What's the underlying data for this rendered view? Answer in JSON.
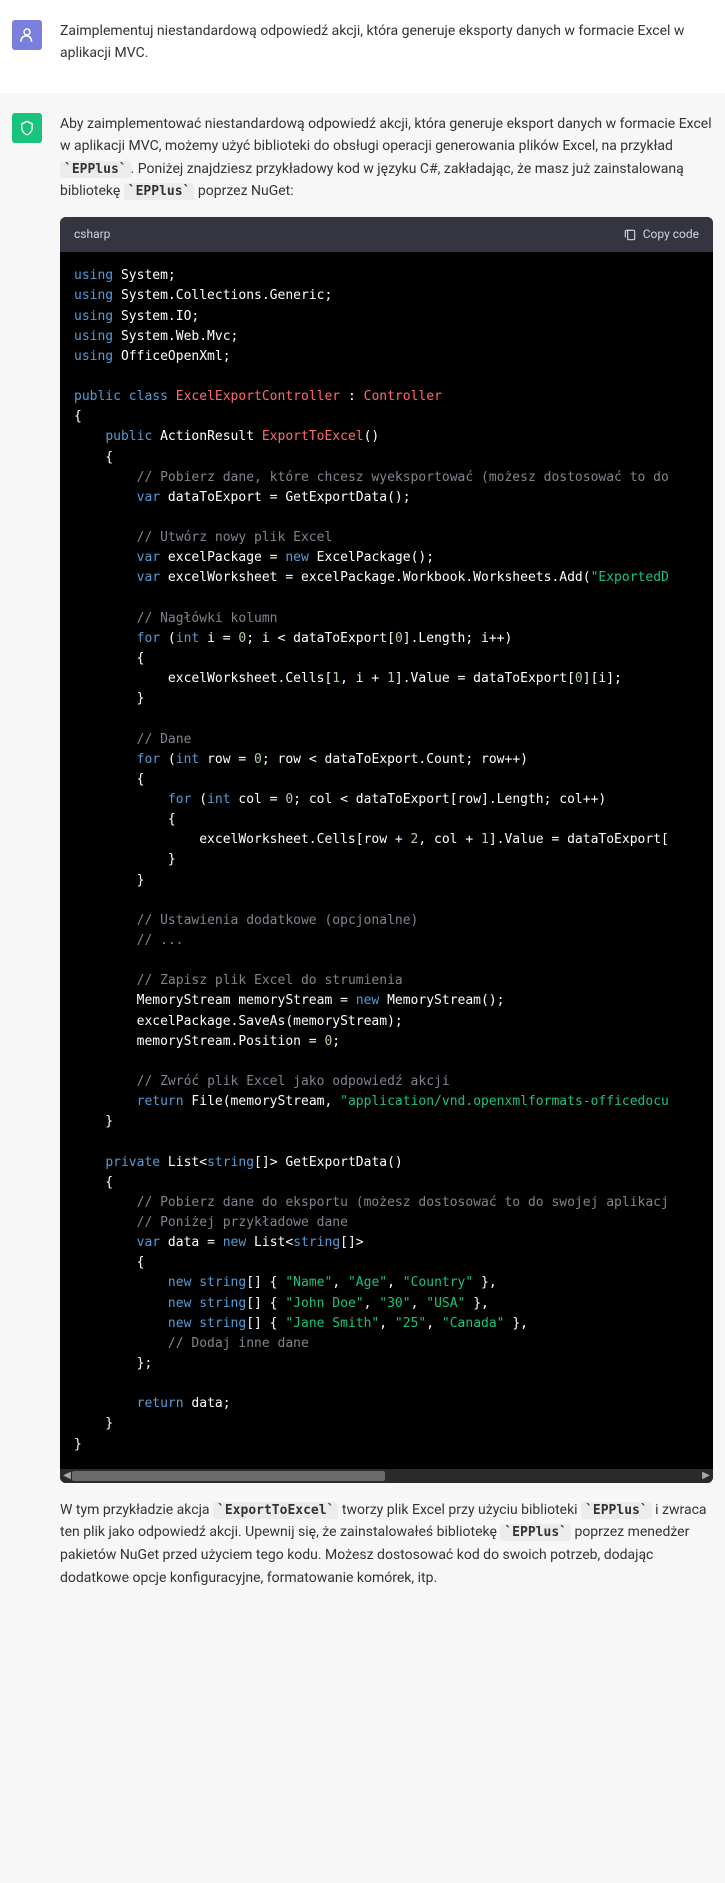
{
  "user": {
    "text": "Zaimplementuj niestandardową odpowiedź akcji, która generuje eksporty danych w formacie Excel w aplikacji MVC."
  },
  "assistant": {
    "intro_parts": [
      "Aby zaimplementować niestandardową odpowiedź akcji, która generuje eksport danych w formacie Excel w aplikacji MVC, możemy użyć biblioteki do obsługi operacji generowania plików Excel, na przykład ",
      ". Poniżej znajdziesz przykładowy kod w języku C#, zakładając, że masz już zainstalowaną bibliotekę ",
      " poprzez NuGet:"
    ],
    "epplus1": "`EPPlus`",
    "epplus2": "`EPPlus`",
    "code_lang": "csharp",
    "copy_label": "Copy code",
    "outro_parts": [
      "W tym przykładzie akcja ",
      " tworzy plik Excel przy użyciu biblioteki ",
      " i zwraca ten plik jako odpowiedź akcji. Upewnij się, że zainstalowałeś bibliotekę ",
      " poprzez menedżer pakietów NuGet przed użyciem tego kodu. Możesz dostosować kod do swoich potrzeb, dodając dodatkowe opcje konfiguracyjne, formatowanie komórek, itp."
    ],
    "export_code": "`ExportToExcel`",
    "epplus3": "`EPPlus`",
    "epplus4": "`EPPlus`"
  }
}
